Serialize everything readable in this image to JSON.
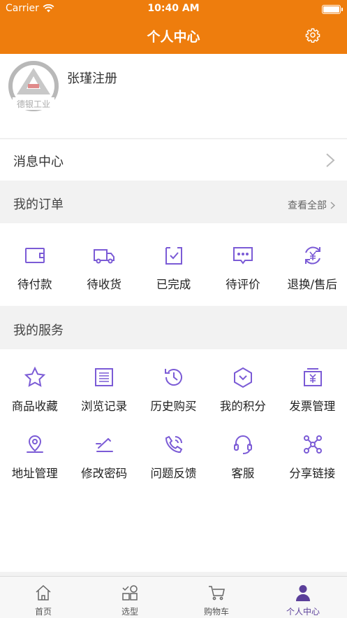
{
  "status_bar": {
    "carrier": "Carrier",
    "time": "10:40 AM"
  },
  "nav": {
    "title": "个人中心",
    "settings_icon": "gear-icon"
  },
  "profile": {
    "name": "张瑾注册",
    "logo_text": "德银工业"
  },
  "messages": {
    "label": "消息中心"
  },
  "orders": {
    "title": "我的订单",
    "view_all": "查看全部",
    "items": [
      {
        "label": "待付款",
        "icon": "wallet-icon"
      },
      {
        "label": "待收货",
        "icon": "truck-icon"
      },
      {
        "label": "已完成",
        "icon": "check-box-icon"
      },
      {
        "label": "待评价",
        "icon": "comment-icon"
      },
      {
        "label": "退换/售后",
        "icon": "refund-icon"
      }
    ]
  },
  "services": {
    "title": "我的服务",
    "items": [
      {
        "label": "商品收藏",
        "icon": "star-icon"
      },
      {
        "label": "浏览记录",
        "icon": "list-icon"
      },
      {
        "label": "历史购买",
        "icon": "history-icon"
      },
      {
        "label": "我的积分",
        "icon": "points-icon"
      },
      {
        "label": "发票管理",
        "icon": "invoice-icon"
      },
      {
        "label": "地址管理",
        "icon": "location-icon"
      },
      {
        "label": "修改密码",
        "icon": "edit-icon"
      },
      {
        "label": "问题反馈",
        "icon": "phone-icon"
      },
      {
        "label": "客服",
        "icon": "headset-icon"
      },
      {
        "label": "分享链接",
        "icon": "share-icon"
      }
    ]
  },
  "tabbar": {
    "items": [
      {
        "label": "首页",
        "icon": "home-icon"
      },
      {
        "label": "选型",
        "icon": "grid-icon"
      },
      {
        "label": "购物车",
        "icon": "cart-icon"
      },
      {
        "label": "个人中心",
        "icon": "user-icon",
        "active": true
      }
    ]
  },
  "colors": {
    "brand": "#ee7d0d",
    "accent": "#7b5bd6",
    "active_tab": "#5b3f9a"
  }
}
